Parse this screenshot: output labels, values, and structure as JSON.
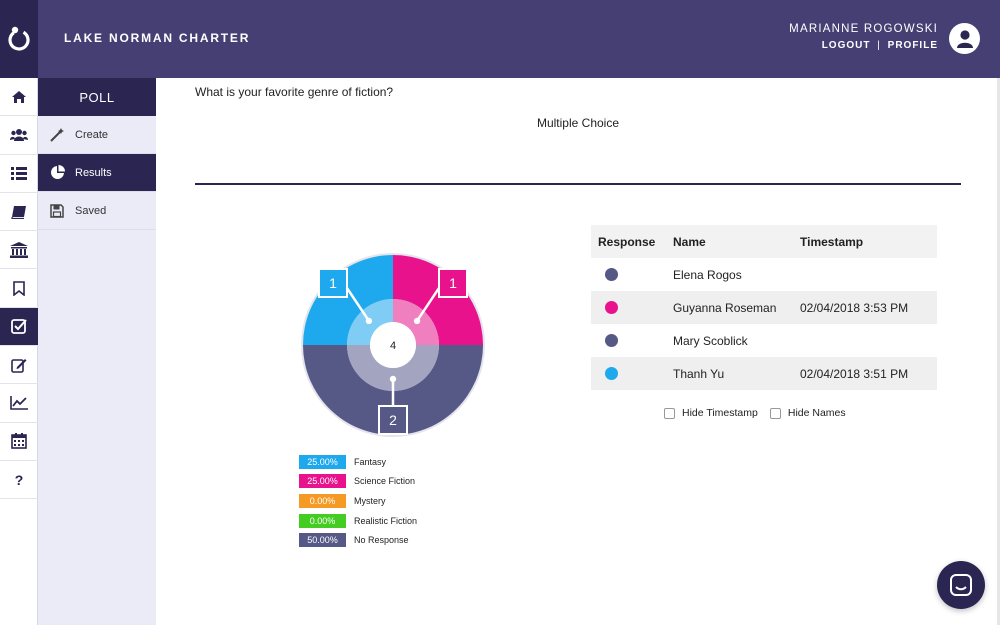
{
  "header": {
    "brand": "LAKE NORMAN CHARTER",
    "user_name": "MARIANNE ROGOWSKI",
    "logout": "LOGOUT",
    "separator": "|",
    "profile": "PROFILE"
  },
  "rail": {
    "icons": [
      "home-icon",
      "users-icon",
      "list-icon",
      "book-icon",
      "institution-icon",
      "bookmark-icon",
      "checkbox-icon",
      "edit-icon",
      "line-chart-icon",
      "calendar-icon",
      "help-icon"
    ],
    "help_glyph": "?"
  },
  "subnav": {
    "title": "POLL",
    "items": [
      {
        "label": "Create",
        "icon": "magic-wand-icon"
      },
      {
        "label": "Results",
        "icon": "pie-chart-icon"
      },
      {
        "label": "Saved",
        "icon": "floppy-disk-icon"
      }
    ]
  },
  "poll": {
    "question": "What is your favorite genre of fiction?",
    "type": "Multiple Choice"
  },
  "chart_data": {
    "type": "pie",
    "center_label": "4",
    "categories": [
      "Fantasy",
      "Science Fiction",
      "Mystery",
      "Realistic Fiction",
      "No Response"
    ],
    "values": [
      25.0,
      25.0,
      0.0,
      0.0,
      50.0
    ],
    "counts": [
      1,
      1,
      0,
      0,
      2
    ],
    "percent_labels": [
      "25.00%",
      "25.00%",
      "0.00%",
      "0.00%",
      "50.00%"
    ],
    "colors": [
      "#1ea8ee",
      "#e8138c",
      "#f59a25",
      "#44cc22",
      "#565886"
    ],
    "inner_colors": [
      "#7fcdf5",
      "#f07fbf",
      "#f8c27f",
      "#92e07b",
      "#a3a4c0"
    ],
    "callouts": [
      "1",
      "1",
      "2"
    ]
  },
  "responses": {
    "headers": [
      "Response",
      "Name",
      "Timestamp"
    ],
    "rows": [
      {
        "color": "#565886",
        "name": "Elena Rogos",
        "timestamp": ""
      },
      {
        "color": "#e8138c",
        "name": "Guyanna Roseman",
        "timestamp": "02/04/2018 3:53 PM"
      },
      {
        "color": "#565886",
        "name": "Mary Scoblick",
        "timestamp": ""
      },
      {
        "color": "#1ea8ee",
        "name": "Thanh Yu",
        "timestamp": "02/04/2018 3:51 PM"
      }
    ],
    "hide_timestamp": "Hide Timestamp",
    "hide_names": "Hide Names"
  },
  "colors": {
    "header": "#463f74",
    "dark": "#2b2552",
    "subnav_bg": "#eaebf7"
  }
}
